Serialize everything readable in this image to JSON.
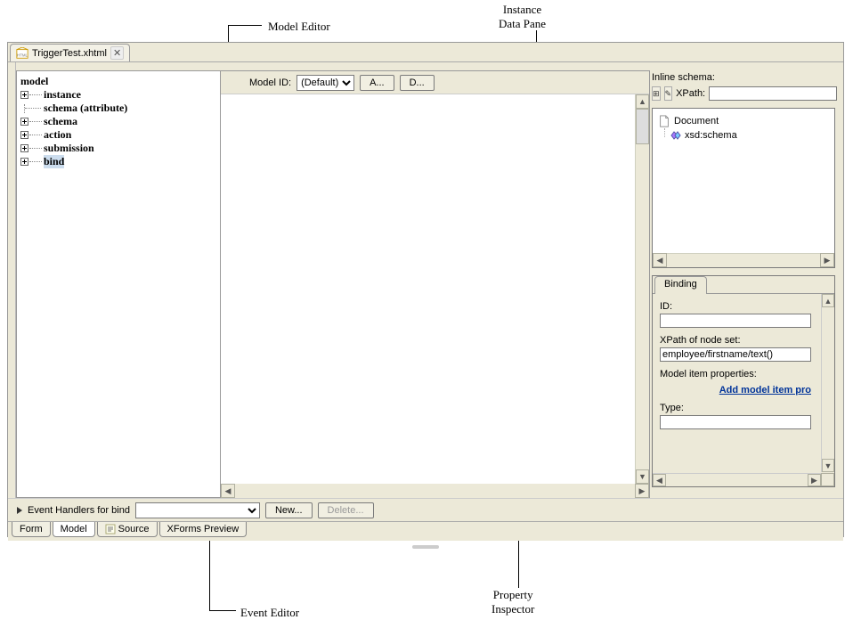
{
  "annotations": {
    "model_editor": "Model Editor",
    "instance_data_pane": "Instance\nData Pane",
    "event_editor": "Event Editor",
    "property_inspector": "Property\nInspector"
  },
  "file_tab": "TriggerTest.xhtml",
  "toolbar": {
    "model_id_label": "Model ID:",
    "model_id_value": "(Default)",
    "btn_a": "A...",
    "btn_d": "D..."
  },
  "tree": {
    "root": "model",
    "items": [
      {
        "label": "instance",
        "expandable": true
      },
      {
        "label": "schema (attribute)",
        "expandable": false
      },
      {
        "label": "schema",
        "expandable": true
      },
      {
        "label": "action",
        "expandable": true
      },
      {
        "label": "submission",
        "expandable": true
      },
      {
        "label": "bind",
        "expandable": true,
        "selected": true
      }
    ]
  },
  "right": {
    "inline_schema_label": "Inline schema:",
    "xpath_label": "XPath:",
    "xpath_value": "",
    "doc_root": "Document",
    "doc_child": "xsd:schema",
    "binding_tab": "Binding",
    "id_label": "ID:",
    "id_value": "",
    "xpath_nodeset_label": "XPath of node set:",
    "xpath_nodeset_value": "employee/firstname/text()",
    "model_item_props_label": "Model item properties:",
    "add_link": "Add model item pro",
    "type_label": "Type:"
  },
  "events": {
    "label": "Event Handlers for bind",
    "dropdown_value": "",
    "btn_new": "New...",
    "btn_delete": "Delete..."
  },
  "bottom_tabs": {
    "form": "Form",
    "model": "Model",
    "source": "Source",
    "xforms_preview": "XForms Preview"
  }
}
